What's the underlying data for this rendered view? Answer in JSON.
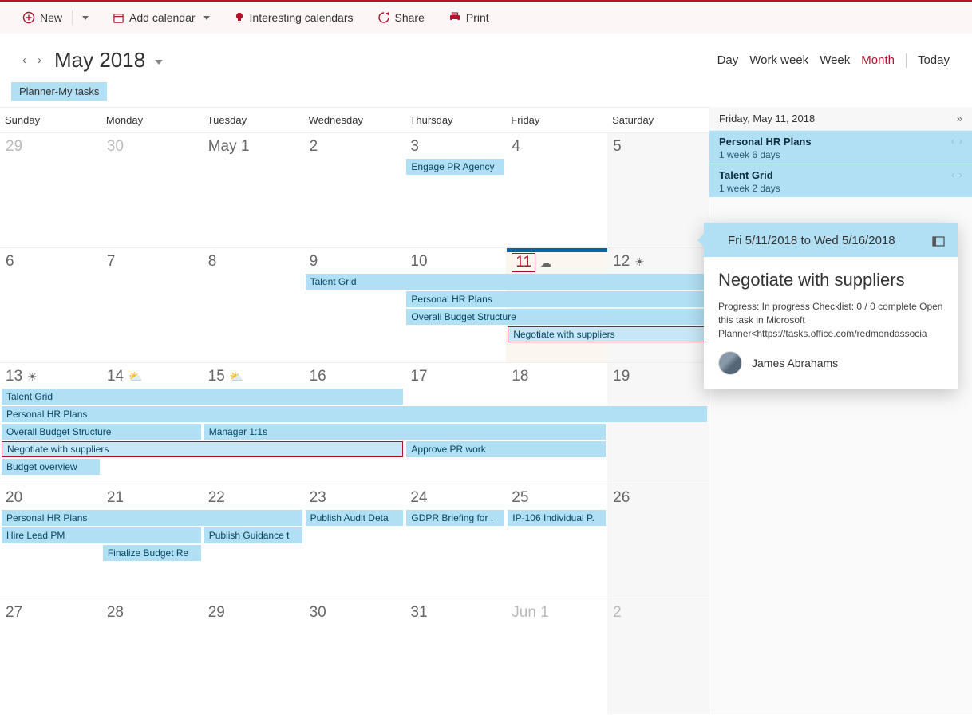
{
  "toolbar": {
    "new": "New",
    "add_calendar": "Add calendar",
    "interesting": "Interesting calendars",
    "share": "Share",
    "print": "Print"
  },
  "header": {
    "month": "May 2018",
    "views": {
      "day": "Day",
      "workweek": "Work week",
      "week": "Week",
      "month": "Month",
      "today": "Today"
    }
  },
  "tag": "Planner-My tasks",
  "dow": [
    "Sunday",
    "Monday",
    "Tuesday",
    "Wednesday",
    "Thursday",
    "Friday",
    "Saturday"
  ],
  "weeks": [
    {
      "days": [
        "29",
        "30",
        "May 1",
        "2",
        "3",
        "4",
        "5"
      ],
      "dim": [
        0,
        1
      ],
      "sel": -1,
      "satIdx": 6,
      "bands": [
        {
          "label": "Engage PR Agency",
          "start": 4,
          "span": 1,
          "row": 0
        }
      ]
    },
    {
      "days": [
        "6",
        "7",
        "8",
        "9",
        "10",
        "11",
        "12"
      ],
      "dim": [],
      "sel": 5,
      "satIdx": 6,
      "wx": {
        "5": "☁",
        "6": "☀"
      },
      "progress": 5,
      "bands": [
        {
          "label": "Talent Grid",
          "start": 3,
          "span": 4,
          "row": 0
        },
        {
          "label": "Personal HR Plans",
          "start": 4,
          "span": 3,
          "row": 1
        },
        {
          "label": "Overall Budget Structure",
          "start": 4,
          "span": 3,
          "row": 2
        },
        {
          "label": "Negotiate with suppliers",
          "start": 5,
          "span": 2,
          "row": 3,
          "outlined": true
        }
      ]
    },
    {
      "days": [
        "13",
        "14",
        "15",
        "16",
        "17",
        "18",
        "19"
      ],
      "dim": [],
      "sel": -1,
      "satIdx": 6,
      "wx": {
        "0": "☀",
        "1": "⛅",
        "2": "⛅"
      },
      "bands": [
        {
          "label": "Talent Grid",
          "start": 0,
          "span": 4,
          "row": 0
        },
        {
          "label": "Personal HR Plans",
          "start": 0,
          "span": 7,
          "row": 1
        },
        {
          "label": "Overall Budget Structure",
          "start": 0,
          "span": 2,
          "row": 2
        },
        {
          "label": "Manager 1:1s",
          "start": 2,
          "span": 4,
          "row": 2
        },
        {
          "label": "Negotiate with suppliers",
          "start": 0,
          "span": 4,
          "row": 3,
          "outlined": true
        },
        {
          "label": "Approve PR work",
          "start": 4,
          "span": 2,
          "row": 3
        },
        {
          "label": "Budget overview",
          "start": 0,
          "span": 1,
          "row": 4
        }
      ]
    },
    {
      "days": [
        "20",
        "21",
        "22",
        "23",
        "24",
        "25",
        "26"
      ],
      "dim": [],
      "sel": -1,
      "satIdx": 6,
      "bands": [
        {
          "label": "Personal HR Plans",
          "start": 0,
          "span": 3,
          "row": 0
        },
        {
          "label": "Publish Audit Deta",
          "start": 3,
          "span": 1,
          "row": 0
        },
        {
          "label": "GDPR Briefing for .",
          "start": 4,
          "span": 1,
          "row": 0
        },
        {
          "label": "IP-106 Individual P.",
          "start": 5,
          "span": 1,
          "row": 0
        },
        {
          "label": "Hire Lead PM",
          "start": 0,
          "span": 2,
          "row": 1
        },
        {
          "label": "Publish Guidance t",
          "start": 2,
          "span": 1,
          "row": 1
        },
        {
          "label": "Finalize Budget Re",
          "start": 1,
          "span": 1,
          "row": 2
        }
      ]
    },
    {
      "days": [
        "27",
        "28",
        "29",
        "30",
        "31",
        "Jun 1",
        "2"
      ],
      "dim": [
        5,
        6
      ],
      "sel": -1,
      "satIdx": 6,
      "bands": []
    }
  ],
  "side": {
    "date": "Friday, May 11, 2018",
    "items": [
      {
        "title": "Personal HR Plans",
        "sub": "1 week 6 days"
      },
      {
        "title": "Talent Grid",
        "sub": "1 week 2 days"
      }
    ]
  },
  "popup": {
    "range": "Fri 5/11/2018 to Wed 5/16/2018",
    "title": "Negotiate with suppliers",
    "desc": "Progress: In progress Checklist: 0 / 0 complete Open this task in Microsoft Planner<https://tasks.office.com/redmondassocia",
    "person": "James Abrahams"
  }
}
